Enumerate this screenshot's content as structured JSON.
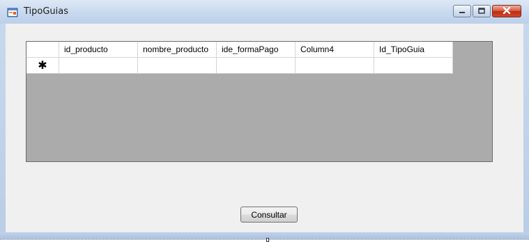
{
  "window": {
    "title": "TipoGuias",
    "icon": "app-form-icon",
    "buttons": [
      "minimize-icon",
      "maximize-icon",
      "close-icon"
    ]
  },
  "grid": {
    "columns": [
      "id_producto",
      "nombre_producto",
      "ide_formaPago",
      "Column4",
      "Id_TipoGuia"
    ],
    "new_row_glyph": "✱",
    "background": "#ababab"
  },
  "actions": {
    "consultar_label": "Consultar"
  }
}
